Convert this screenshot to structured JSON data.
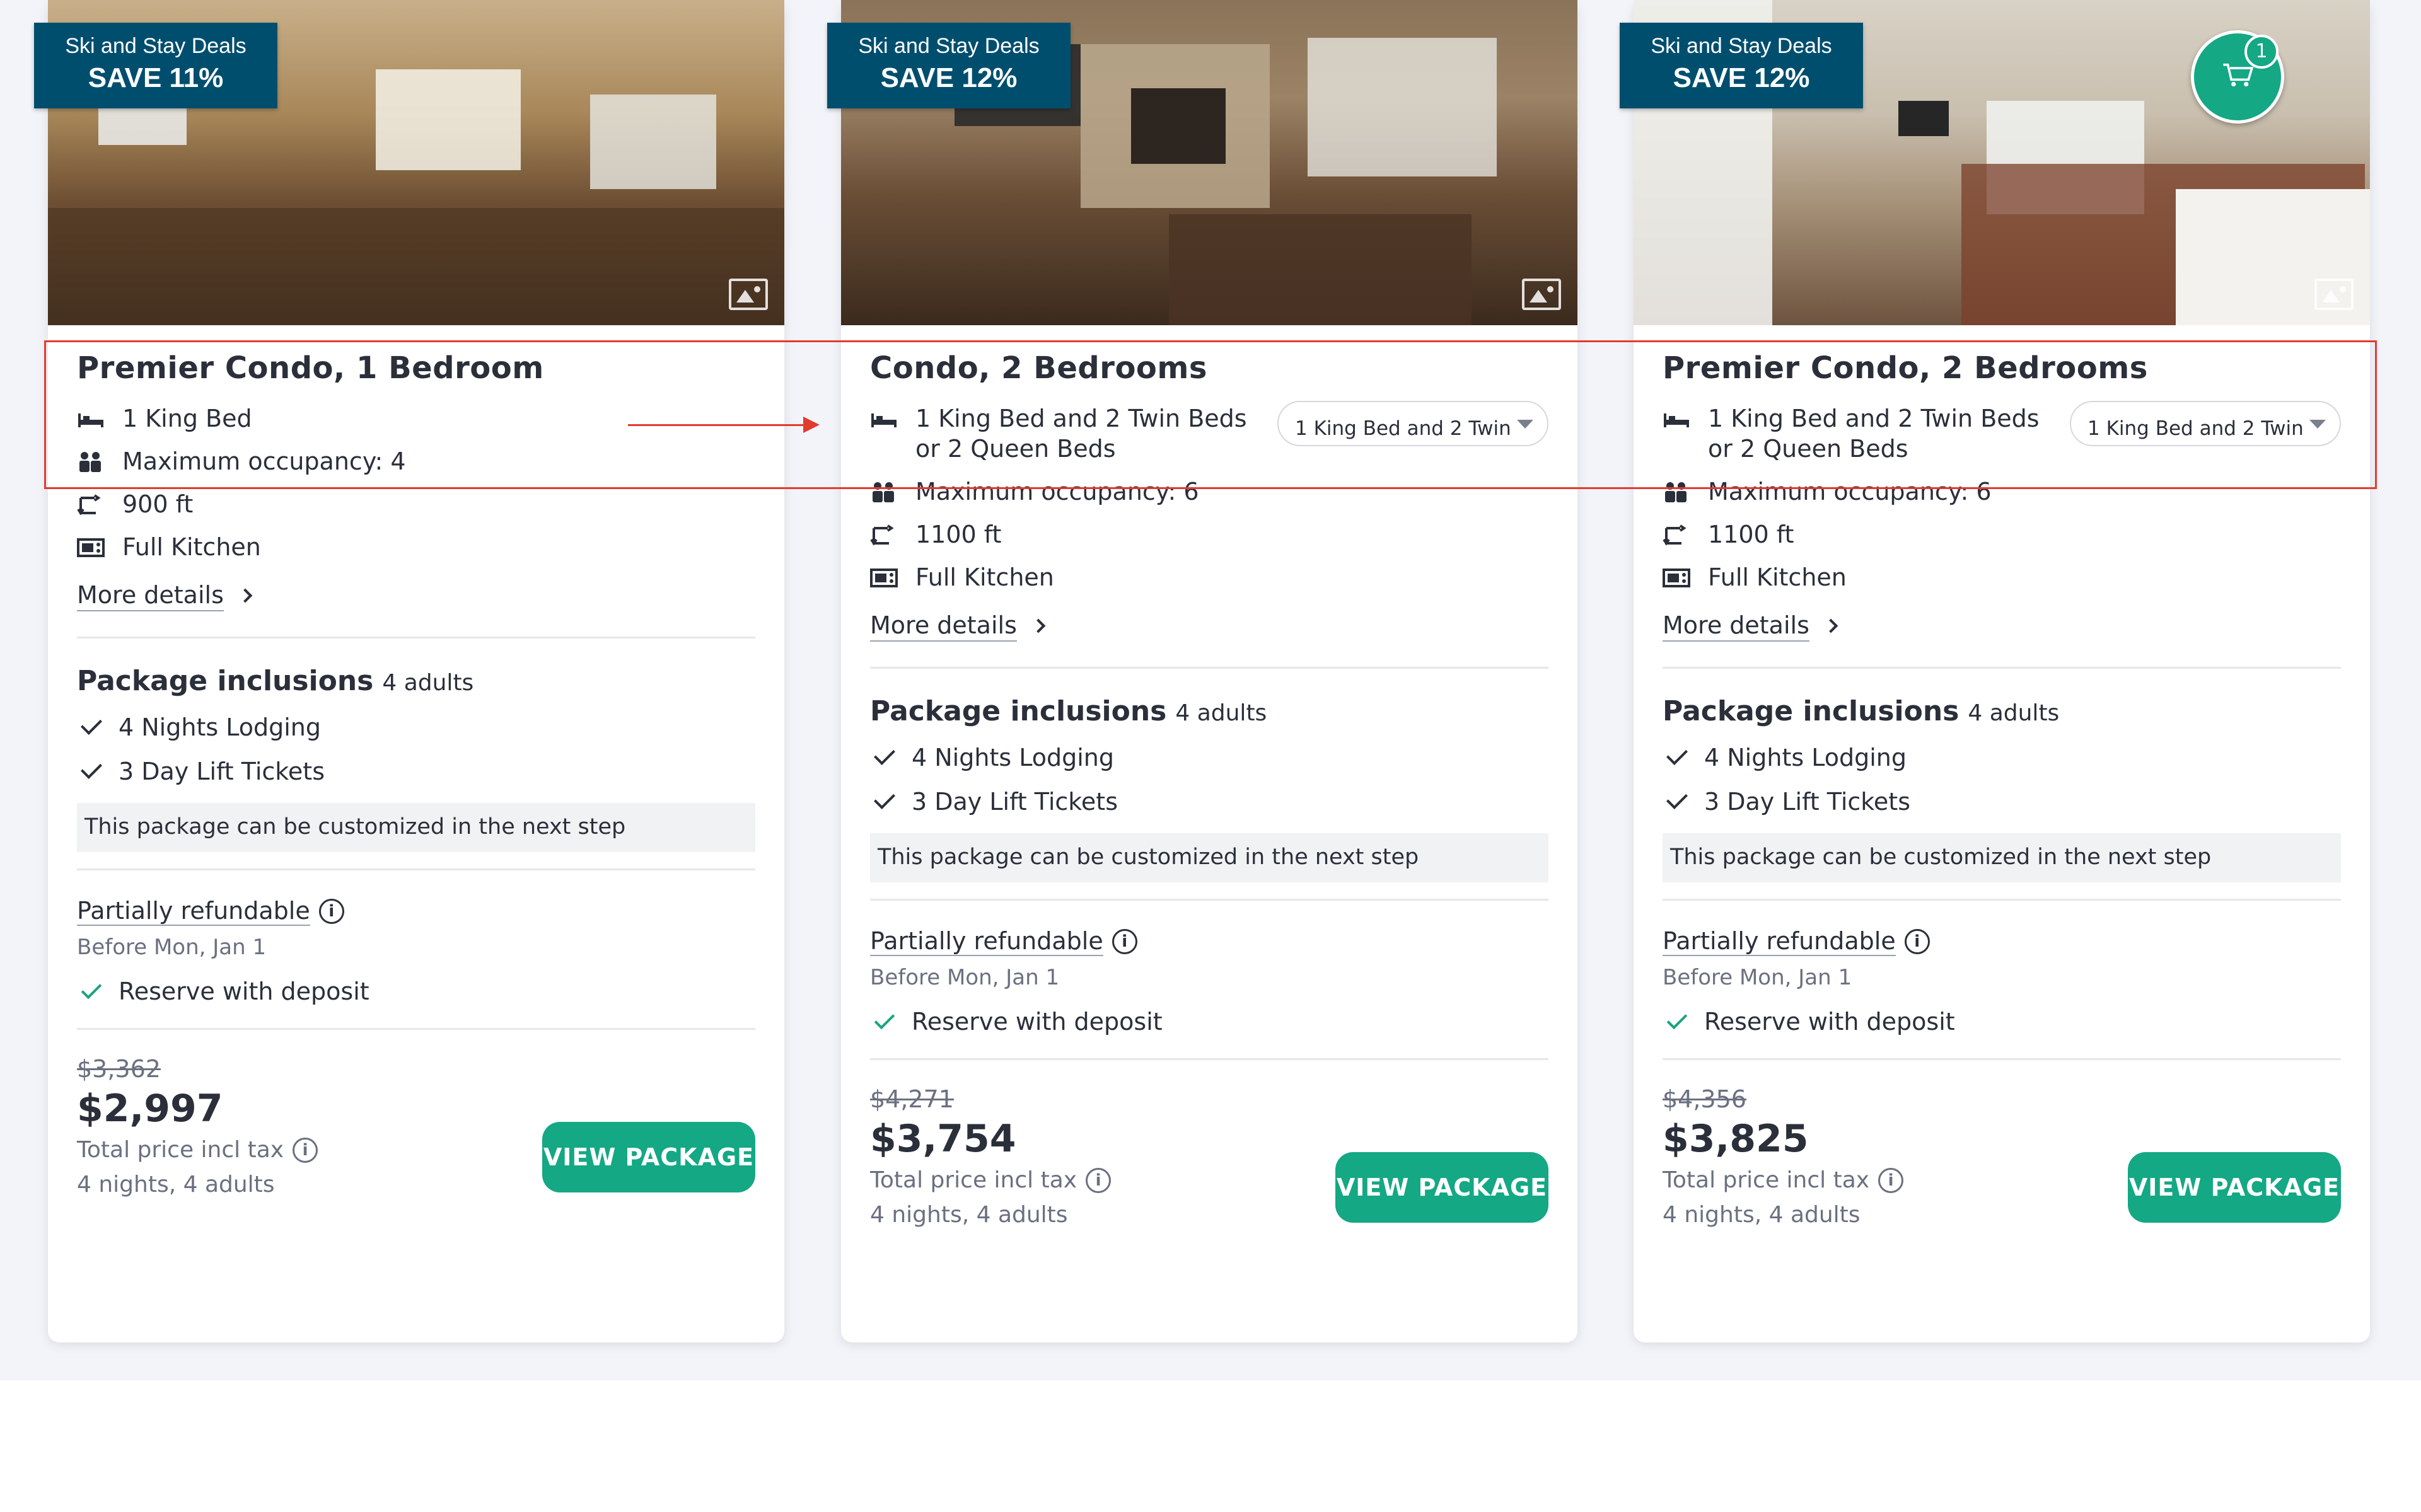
{
  "cards": [
    {
      "deal_line1": "Ski and Stay Deals",
      "deal_line2": "SAVE 11%",
      "title": "Premier Condo, 1 Bedroom",
      "beds": "1 King Bed",
      "occupancy": "Maximum occupancy: 4",
      "size": "900 ft",
      "kitchen": "Full Kitchen",
      "more": "More details",
      "pk_title": "Package inclusions",
      "pk_sub": "4 adults",
      "inc1": "4 Nights Lodging",
      "inc2": "3 Day Lift Tickets",
      "note": "This package can be customized in the next step",
      "refund": "Partially refundable",
      "before": "Before Mon, Jan 1",
      "deposit": "Reserve with deposit",
      "old_price": "$3,362",
      "price": "$2,997",
      "tax": "Total price incl tax",
      "nights": "4 nights, 4 adults",
      "button": "VIEW PACKAGE"
    },
    {
      "deal_line1": "Ski and Stay Deals",
      "deal_line2": "SAVE 12%",
      "title": "Condo, 2 Bedrooms",
      "beds": "1 King Bed and 2 Twin Beds or 2 Queen Beds",
      "bed_select": "1 King Bed and 2 Twin",
      "occupancy": "Maximum occupancy: 6",
      "size": "1100 ft",
      "kitchen": "Full Kitchen",
      "more": "More details",
      "pk_title": "Package inclusions",
      "pk_sub": "4 adults",
      "inc1": "4 Nights Lodging",
      "inc2": "3 Day Lift Tickets",
      "note": "This package can be customized in the next step",
      "refund": "Partially refundable",
      "before": "Before Mon, Jan 1",
      "deposit": "Reserve with deposit",
      "old_price": "$4,271",
      "price": "$3,754",
      "tax": "Total price incl tax",
      "nights": "4 nights, 4 adults",
      "button": "VIEW PACKAGE"
    },
    {
      "deal_line1": "Ski and Stay Deals",
      "deal_line2": "SAVE 12%",
      "title": "Premier Condo, 2 Bedrooms",
      "beds": "1 King Bed and 2 Twin Beds or 2 Queen Beds",
      "bed_select": "1 King Bed and 2 Twin",
      "occupancy": "Maximum occupancy: 6",
      "size": "1100 ft",
      "kitchen": "Full Kitchen",
      "more": "More details",
      "pk_title": "Package inclusions",
      "pk_sub": "4 adults",
      "inc1": "4 Nights Lodging",
      "inc2": "3 Day Lift Tickets",
      "note": "This package can be customized in the next step",
      "refund": "Partially refundable",
      "before": "Before Mon, Jan 1",
      "deposit": "Reserve with deposit",
      "old_price": "$4,356",
      "price": "$3,825",
      "tax": "Total price incl tax",
      "nights": "4 nights, 4 adults",
      "button": "VIEW PACKAGE"
    }
  ],
  "cart": {
    "count": "1"
  },
  "colors": {
    "accent": "#14a884",
    "badge": "#004e6e",
    "annotation": "#e23b2f"
  }
}
